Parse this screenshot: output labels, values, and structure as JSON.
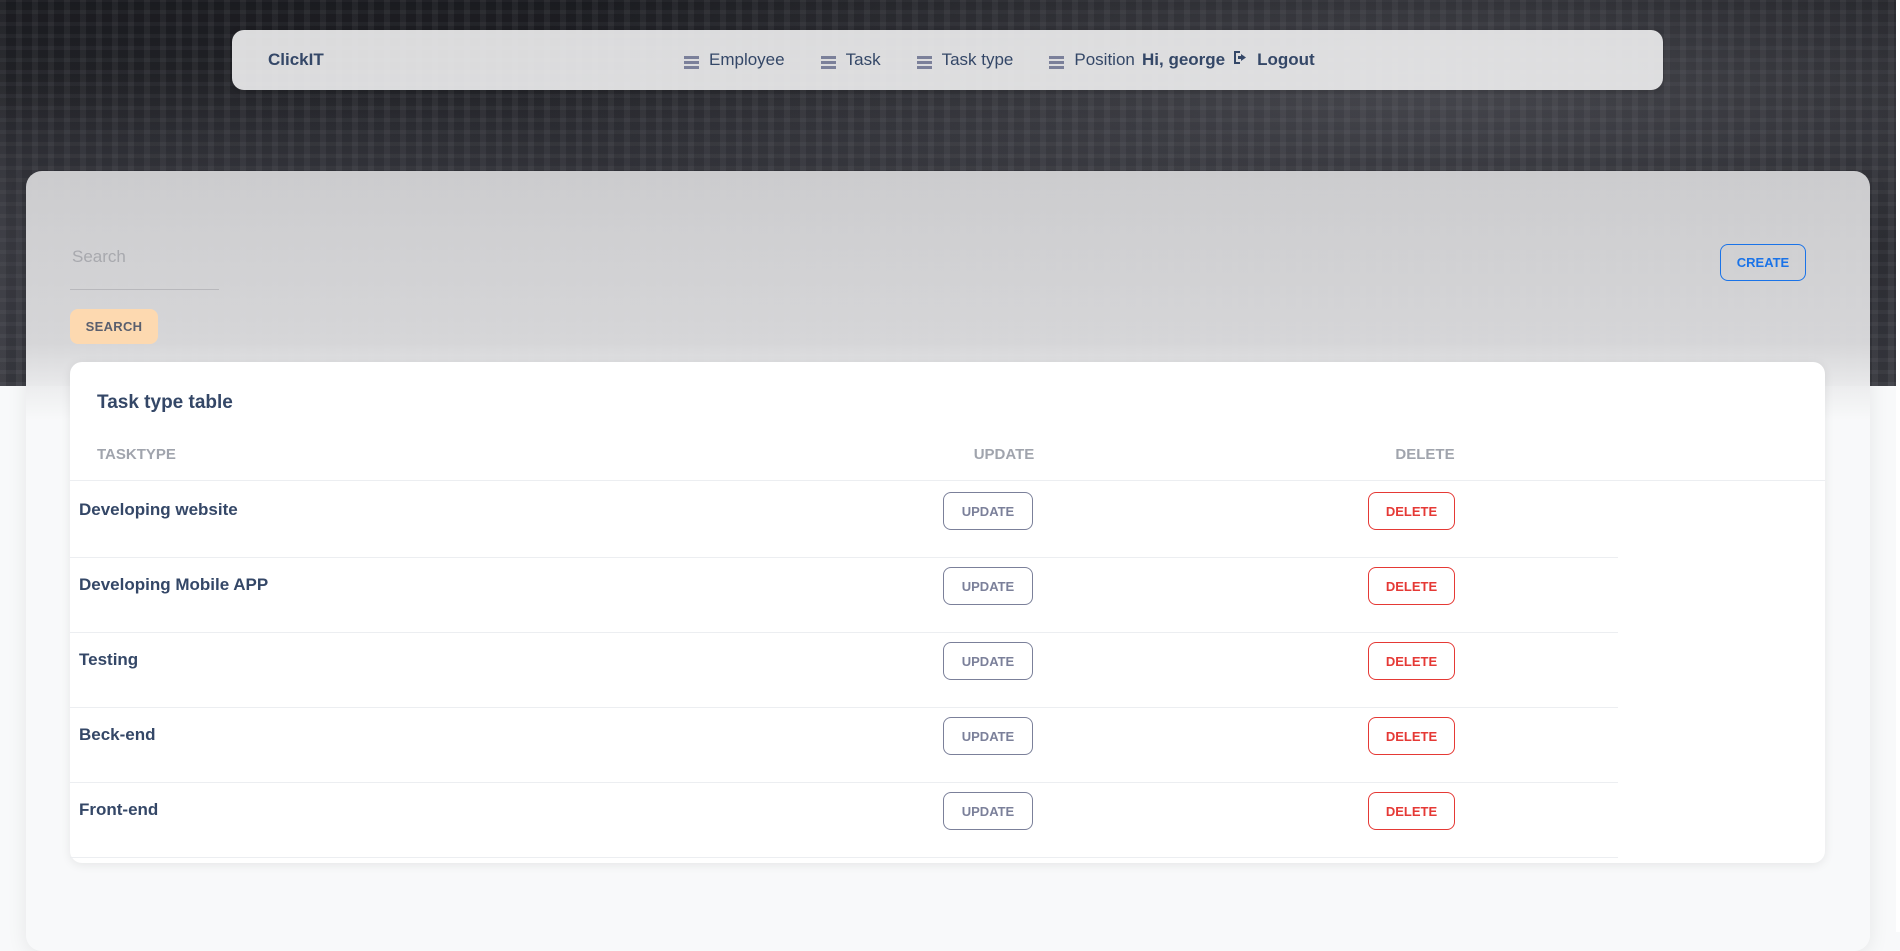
{
  "navbar": {
    "brand": "ClickIT",
    "links": [
      {
        "label": "Employee",
        "icon": "table-icon"
      },
      {
        "label": "Task",
        "icon": "table-icon"
      },
      {
        "label": "Task type",
        "icon": "table-icon"
      },
      {
        "label": "Position",
        "icon": "table-icon"
      }
    ],
    "greeting": "Hi, george",
    "logout_label": "Logout",
    "logout_icon": "logout-icon"
  },
  "search": {
    "placeholder": "Search",
    "value": "",
    "button_label": "SEARCH"
  },
  "create_label": "CREATE",
  "table": {
    "title": "Task type table",
    "columns": [
      "TASKTYPE",
      "UPDATE",
      "DELETE"
    ],
    "rows": [
      {
        "tasktype": "Developing website",
        "update_label": "UPDATE",
        "delete_label": "DELETE"
      },
      {
        "tasktype": "Developing Mobile APP",
        "update_label": "UPDATE",
        "delete_label": "DELETE"
      },
      {
        "tasktype": "Testing",
        "update_label": "UPDATE",
        "delete_label": "DELETE"
      },
      {
        "tasktype": "Beck-end",
        "update_label": "UPDATE",
        "delete_label": "DELETE"
      },
      {
        "tasktype": "Front-end",
        "update_label": "UPDATE",
        "delete_label": "DELETE"
      }
    ]
  },
  "colors": {
    "text_primary": "#344767",
    "accent_blue": "#1a73e8",
    "danger": "#e53935",
    "search_button_bg": "#fdd9b0"
  }
}
